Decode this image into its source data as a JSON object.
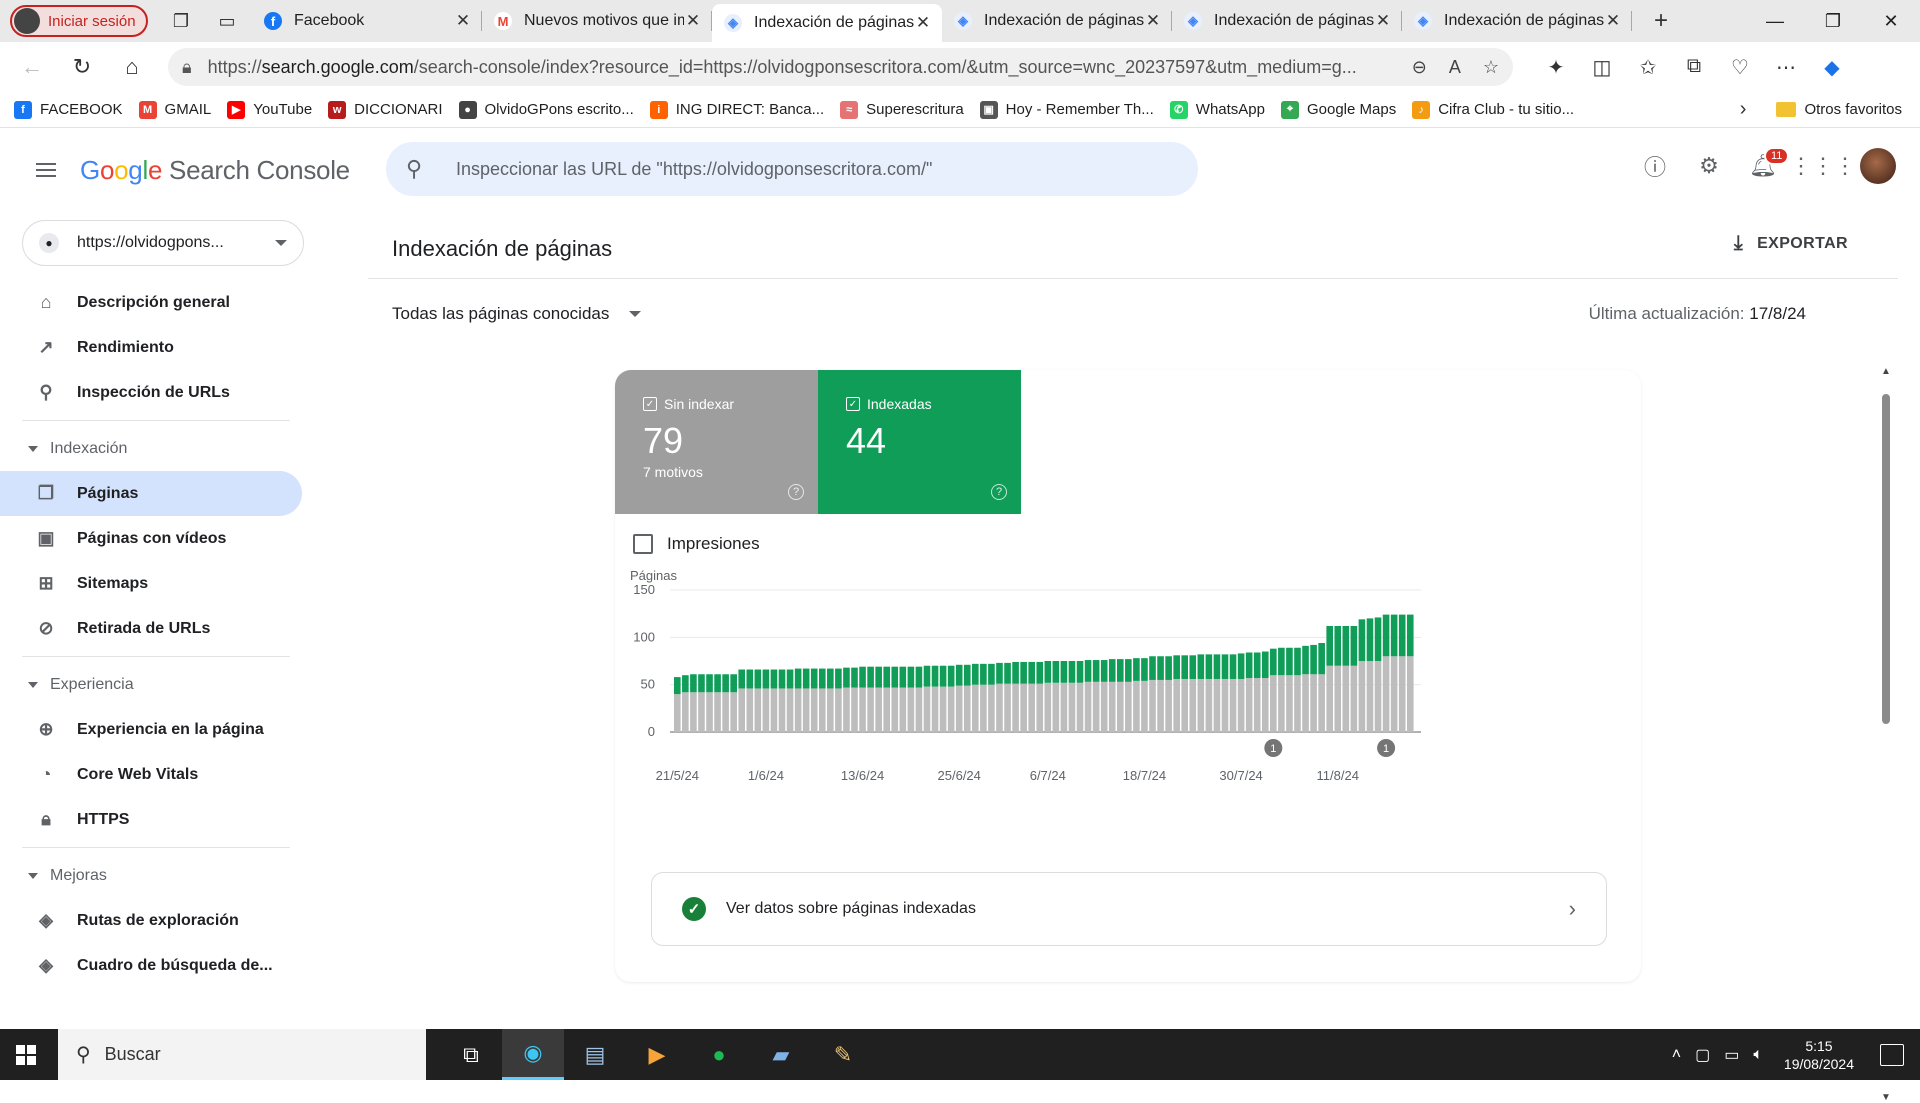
{
  "browser": {
    "profile_label": "Iniciar sesión",
    "tabs": [
      {
        "title": "Facebook",
        "icon": "facebook-icon",
        "active": false
      },
      {
        "title": "Nuevos motivos que impiden",
        "icon": "gmail-icon",
        "active": false
      },
      {
        "title": "Indexación de páginas",
        "icon": "search-console-icon",
        "active": true
      },
      {
        "title": "Indexación de páginas",
        "icon": "search-console-icon",
        "active": false
      },
      {
        "title": "Indexación de páginas",
        "icon": "search-console-icon",
        "active": false
      },
      {
        "title": "Indexación de páginas",
        "icon": "search-console-icon",
        "active": false
      }
    ],
    "url_prefix": "https://",
    "url_host": "search.google.com",
    "url_rest": "/search-console/index?resource_id=https://olvidogponsescritora.com/&utm_source=wnc_20237597&utm_medium=g...",
    "bookmarks": [
      {
        "label": "FACEBOOK",
        "color": "#1877f2",
        "glyph": "f"
      },
      {
        "label": "GMAIL",
        "color": "#ea4335",
        "glyph": "M"
      },
      {
        "label": "YouTube",
        "color": "#ff0000",
        "glyph": "▶"
      },
      {
        "label": "DICCIONARI",
        "color": "#b71c1c",
        "glyph": "w"
      },
      {
        "label": "OlvidoGPons escrito...",
        "color": "#444444",
        "glyph": "●"
      },
      {
        "label": "ING DIRECT: Banca...",
        "color": "#ff6200",
        "glyph": "i"
      },
      {
        "label": "Superescritura",
        "color": "#e57373",
        "glyph": "≈"
      },
      {
        "label": "Hoy - Remember Th...",
        "color": "#555555",
        "glyph": "▣"
      },
      {
        "label": "WhatsApp",
        "color": "#25d366",
        "glyph": "✆"
      },
      {
        "label": "Google Maps",
        "color": "#34a853",
        "glyph": "⌖"
      },
      {
        "label": "Cifra Club - tu sitio...",
        "color": "#f39c12",
        "glyph": "♪"
      }
    ],
    "other_favorites": "Otros favoritos"
  },
  "app": {
    "logo_google": "Google",
    "logo_product": "Search Console",
    "search_placeholder": "Inspeccionar las URL de \"https://olvidogponsescritora.com/\"",
    "notifications_count": "11",
    "property": "https://olvidogpons...",
    "nav": {
      "top": [
        {
          "label": "Descripción general",
          "icon": "home-icon"
        },
        {
          "label": "Rendimiento",
          "icon": "trending-up-icon"
        },
        {
          "label": "Inspección de URLs",
          "icon": "search-icon"
        }
      ],
      "sections": [
        {
          "title": "Indexación",
          "items": [
            {
              "label": "Páginas",
              "icon": "pages-icon",
              "active": true
            },
            {
              "label": "Páginas con vídeos",
              "icon": "video-pages-icon"
            },
            {
              "label": "Sitemaps",
              "icon": "sitemap-icon"
            },
            {
              "label": "Retirada de URLs",
              "icon": "eye-off-icon"
            }
          ]
        },
        {
          "title": "Experiencia",
          "items": [
            {
              "label": "Experiencia en la página",
              "icon": "plus-circle-icon"
            },
            {
              "label": "Core Web Vitals",
              "icon": "gauge-icon"
            },
            {
              "label": "HTTPS",
              "icon": "lock-icon"
            }
          ]
        },
        {
          "title": "Mejoras",
          "items": [
            {
              "label": "Rutas de exploración",
              "icon": "layers-icon"
            },
            {
              "label": "Cuadro de búsqueda de...",
              "icon": "layers-icon"
            }
          ]
        }
      ]
    }
  },
  "main": {
    "title": "Indexación de páginas",
    "export_label": "EXPORTAR",
    "filter_label": "Todas las páginas conocidas",
    "updated_label": "Última actualización:",
    "updated_value": "17/8/24",
    "metrics": [
      {
        "label": "Sin indexar",
        "value": "79",
        "sub": "7 motivos",
        "color": "#9e9e9e"
      },
      {
        "label": "Indexadas",
        "value": "44",
        "sub": "",
        "color": "#0f9d58"
      }
    ],
    "impressions_label": "Impresiones",
    "insight_label": "Ver datos sobre páginas indexadas"
  },
  "chart_data": {
    "type": "bar",
    "stacked": true,
    "ylabel": "Páginas",
    "ylim": [
      0,
      150
    ],
    "yticks": [
      0,
      50,
      100,
      150
    ],
    "grid": true,
    "xtick_labels": [
      "21/5/24",
      "1/6/24",
      "13/6/24",
      "25/6/24",
      "6/7/24",
      "18/7/24",
      "30/7/24",
      "11/8/24"
    ],
    "xtick_indices": [
      0,
      11,
      23,
      35,
      46,
      58,
      70,
      82
    ],
    "annotations": [
      {
        "index": 74,
        "text": "1"
      },
      {
        "index": 88,
        "text": "1"
      }
    ],
    "series": [
      {
        "name": "Sin indexar",
        "color": "#bdbdbd",
        "values": [
          40,
          42,
          42,
          42,
          42,
          42,
          42,
          42,
          46,
          46,
          46,
          46,
          46,
          46,
          46,
          46,
          46,
          46,
          46,
          46,
          46,
          47,
          47,
          47,
          47,
          47,
          47,
          47,
          47,
          47,
          47,
          48,
          48,
          48,
          48,
          49,
          49,
          50,
          50,
          50,
          51,
          51,
          51,
          51,
          51,
          51,
          52,
          52,
          52,
          52,
          52,
          53,
          53,
          53,
          53,
          53,
          53,
          54,
          54,
          55,
          55,
          55,
          56,
          56,
          56,
          56,
          56,
          56,
          56,
          56,
          56,
          57,
          57,
          57,
          60,
          60,
          60,
          60,
          61,
          61,
          61,
          70,
          70,
          70,
          70,
          75,
          75,
          75,
          80,
          80,
          80,
          80
        ]
      },
      {
        "name": "Indexadas",
        "color": "#0f9d58",
        "values": [
          18,
          18,
          19,
          19,
          19,
          19,
          19,
          19,
          20,
          20,
          20,
          20,
          20,
          20,
          20,
          21,
          21,
          21,
          21,
          21,
          21,
          21,
          21,
          22,
          22,
          22,
          22,
          22,
          22,
          22,
          22,
          22,
          22,
          22,
          22,
          22,
          22,
          22,
          22,
          22,
          22,
          22,
          23,
          23,
          23,
          23,
          23,
          23,
          23,
          23,
          23,
          23,
          23,
          23,
          24,
          24,
          24,
          24,
          24,
          25,
          25,
          25,
          25,
          25,
          25,
          26,
          26,
          26,
          26,
          26,
          27,
          27,
          27,
          28,
          28,
          29,
          29,
          29,
          30,
          31,
          33,
          42,
          42,
          42,
          42,
          44,
          45,
          46,
          44,
          44,
          44,
          44
        ]
      }
    ]
  }
}
